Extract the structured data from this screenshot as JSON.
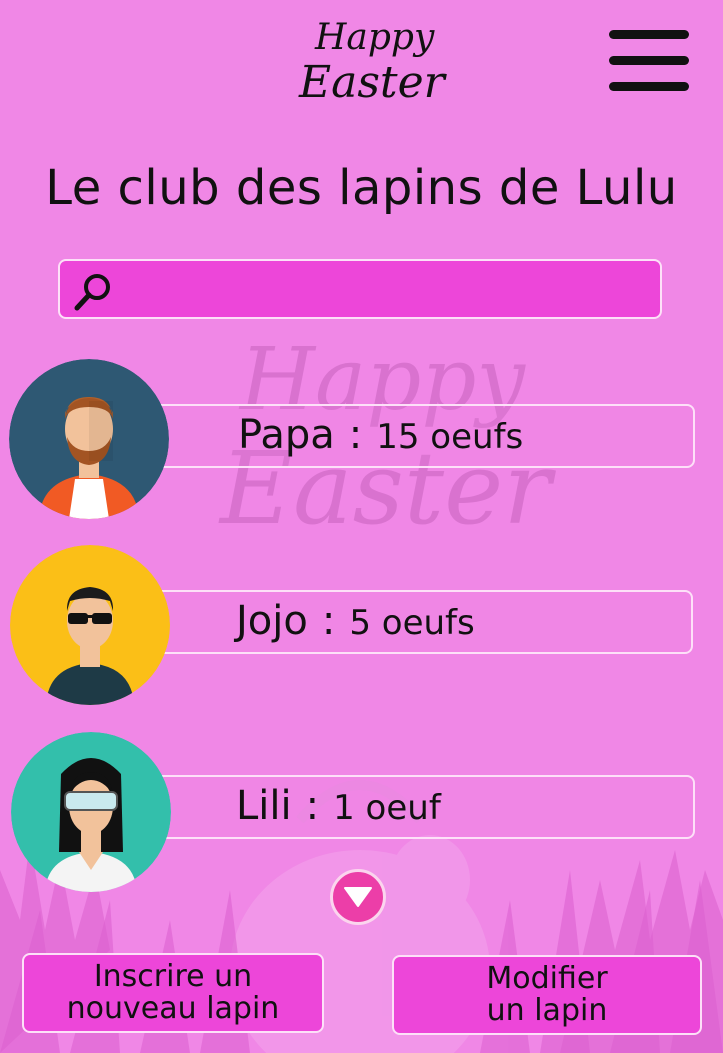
{
  "header": {
    "logo_line1": "Happy",
    "logo_line2": "Easter"
  },
  "title": "Le club des lapins de Lulu",
  "search": {
    "value": "",
    "placeholder": ""
  },
  "watermark": {
    "line1": "Happy",
    "line2": "Easter"
  },
  "members": [
    {
      "name": "Papa",
      "separator": ":",
      "eggs": "15 oeufs",
      "avatar_bg": "#2e5873"
    },
    {
      "name": "Jojo",
      "separator": ":",
      "eggs": "5 oeufs",
      "avatar_bg": "#fbbf17"
    },
    {
      "name": "Lili",
      "separator": ":",
      "eggs": "1 oeuf",
      "avatar_bg": "#33bfab"
    }
  ],
  "actions": {
    "register_line1": "Inscrire un",
    "register_line2": "nouveau lapin",
    "modify_line1": "Modifier",
    "modify_line2": "un lapin"
  },
  "colors": {
    "background": "#f087e6",
    "accent": "#ed46d9",
    "border": "#fde0f8",
    "scroll_button": "#ec3ea8"
  },
  "icons": [
    "menu-icon",
    "search-icon",
    "chevron-down-icon"
  ]
}
